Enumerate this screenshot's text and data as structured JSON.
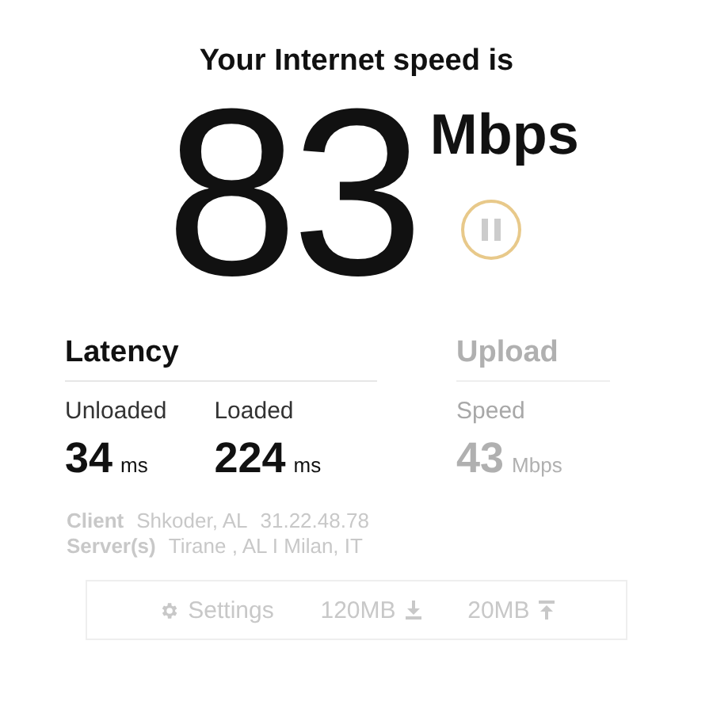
{
  "heading": "Your Internet speed is",
  "speed": {
    "value": "83",
    "unit": "Mbps"
  },
  "pause_button": {
    "paused": false
  },
  "sections": [
    {
      "title": "Latency",
      "dimmed": false,
      "metrics": [
        {
          "label": "Unloaded",
          "value": "34",
          "unit": "ms"
        },
        {
          "label": "Loaded",
          "value": "224",
          "unit": "ms"
        }
      ]
    },
    {
      "title": "Upload",
      "dimmed": true,
      "metrics": [
        {
          "label": "Speed",
          "value": "43",
          "unit": "Mbps"
        }
      ]
    }
  ],
  "info": [
    {
      "label": "Client",
      "parts": [
        "Shkoder, AL",
        "31.22.48.78"
      ]
    },
    {
      "label": "Server(s)",
      "parts": [
        "Tirane , AL  I  Milan, IT"
      ]
    }
  ],
  "toolbar": [
    {
      "kind": "settings",
      "label": "Settings"
    },
    {
      "kind": "download",
      "label": "120MB"
    },
    {
      "kind": "upload",
      "label": "20MB"
    }
  ]
}
